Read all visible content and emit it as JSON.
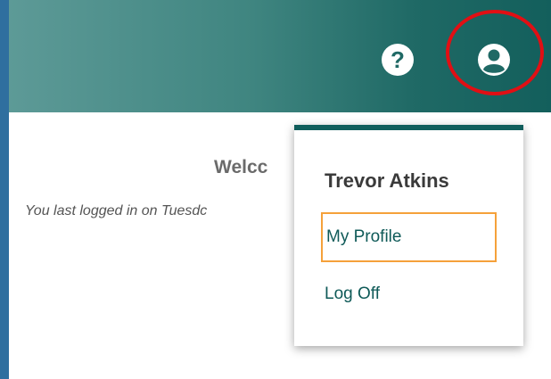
{
  "header": {
    "help_icon": "help-icon",
    "user_icon": "account-circle-icon"
  },
  "content": {
    "welcome": "Welcc",
    "last_login": "You last logged in on Tuesdc"
  },
  "user_menu": {
    "user_name": "Trevor Atkins",
    "items": [
      {
        "label": "My Profile",
        "focused": true
      },
      {
        "label": "Log Off",
        "focused": false
      }
    ]
  },
  "colors": {
    "header_gradient_start": "#5d9a97",
    "header_gradient_end": "#135f5c",
    "menu_accent": "#105e5c",
    "link_text": "#0f5a58",
    "focus_outline": "#f5a13a",
    "annotation_ring": "#e10f14",
    "outer_border": "#2f6f9f"
  }
}
